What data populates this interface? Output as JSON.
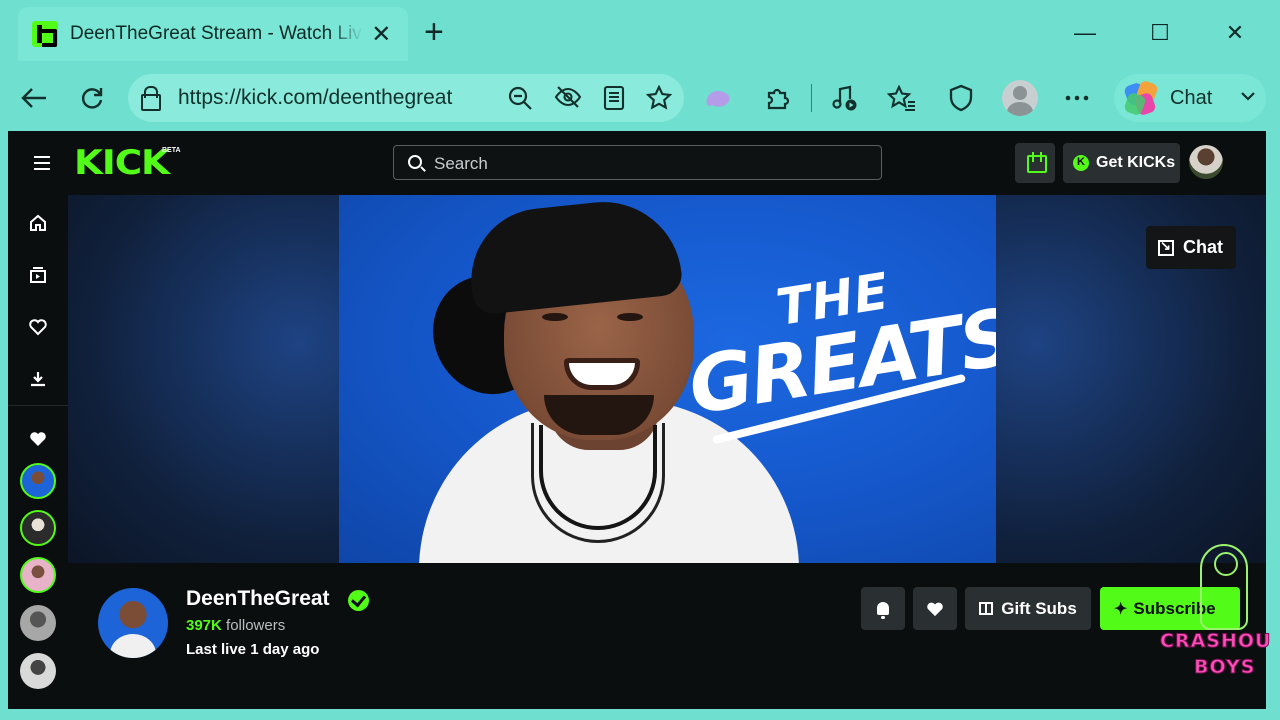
{
  "browser": {
    "tab_title": "DeenTheGreat Stream - Watch Live on Kick",
    "new_tab": "+",
    "close_tab": "✕",
    "url": "https://kick.com/deenthegreat",
    "copilot_label": "Chat",
    "window_controls": {
      "minimize": "—",
      "maximize": "☐",
      "close": "✕"
    },
    "toolbar_icons": [
      "back-icon",
      "refresh-icon",
      "lock-icon",
      "zoom-icon",
      "tracking-icon",
      "reader-icon",
      "favorite-icon",
      "extension-blob-icon",
      "extensions-icon",
      "media-icon",
      "favorites-icon",
      "shield-icon",
      "profile-icon",
      "more-icon",
      "copilot-icon",
      "chevron-down-icon"
    ]
  },
  "kick": {
    "logo": "KICK",
    "beta": "BETA",
    "search_placeholder": "Search",
    "get_kicks": "Get KICKs",
    "brand_color": "#53fc18",
    "sidebar_icons": [
      "home-icon",
      "browse-icon",
      "following-icon",
      "downloads-icon",
      "followed-heart-icon"
    ],
    "banner": {
      "line1": "THE",
      "line2": "GREATS"
    },
    "chat_button": "Chat",
    "channel": {
      "name": "DeenTheGreat",
      "followers_count": "397K",
      "followers_label": "followers",
      "last_live": "Last live 1 day ago"
    },
    "actions": {
      "gift_subs": "Gift Subs",
      "subscribe": "Subscribe"
    }
  },
  "watermark": {
    "line1": "CRASHOU",
    "line2": "BOYS"
  }
}
